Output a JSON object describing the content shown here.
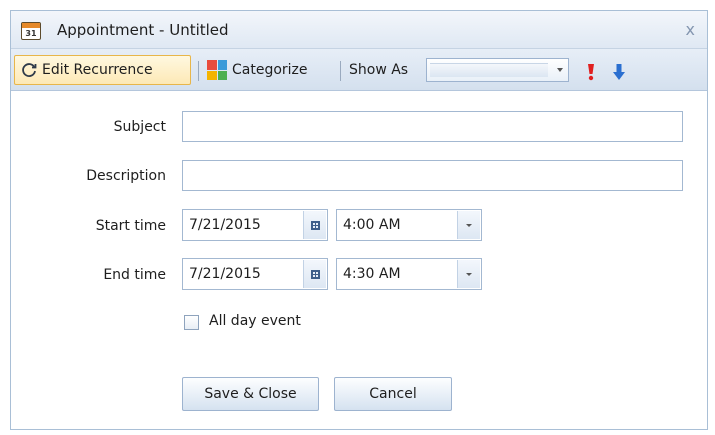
{
  "window": {
    "title": "Appointment - Untitled",
    "calendar_icon_day": "31",
    "close_glyph": "x"
  },
  "toolbar": {
    "edit_recurrence_label": "Edit Recurrence",
    "categorize_label": "Categorize",
    "show_as_label": "Show As",
    "show_as_value": ""
  },
  "form": {
    "subject_label": "Subject",
    "subject_value": "",
    "description_label": "Description",
    "description_value": "",
    "start_time_label": "Start time",
    "start_date": "7/21/2015",
    "start_time": "4:00 AM",
    "end_time_label": "End time",
    "end_date": "7/21/2015",
    "end_time": "4:30 AM",
    "all_day_label": "All day event",
    "all_day_checked": false
  },
  "buttons": {
    "save_close": "Save & Close",
    "cancel": "Cancel"
  },
  "colors": {
    "accent_border": "#a3b8d1",
    "highlight": "#e8b64a",
    "priority_high": "#e02020",
    "priority_low": "#2a6fd0"
  }
}
